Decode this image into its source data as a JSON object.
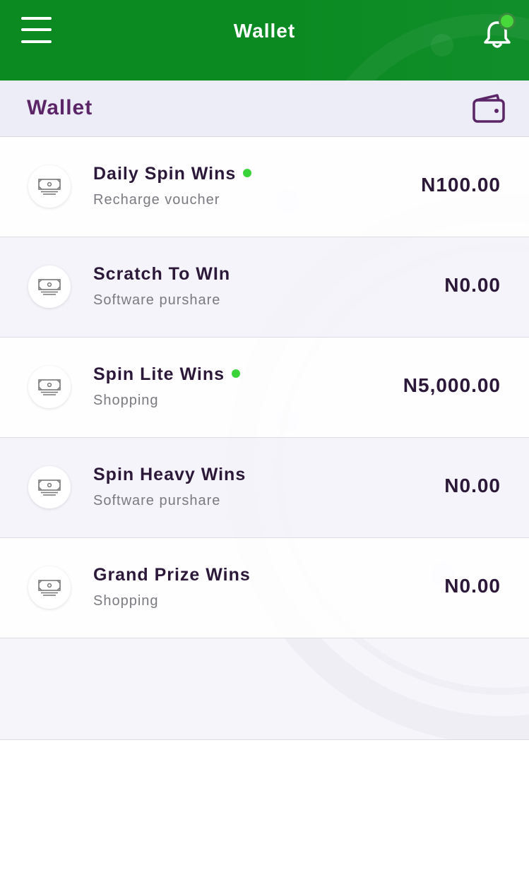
{
  "header": {
    "title": "Wallet",
    "menu_icon": "hamburger-menu-icon",
    "bell_icon": "notification-bell-icon",
    "bell_badge_color": "#47d83a",
    "background_color": "#0b8a22"
  },
  "section": {
    "title": "Wallet",
    "icon": "wallet-icon",
    "title_color": "#5b2567"
  },
  "wallets": [
    {
      "name": "Daily Spin Wins",
      "subtitle": "Recharge voucher",
      "amount": "N100.00",
      "active": true
    },
    {
      "name": "Scratch To WIn",
      "subtitle": "Software purshare",
      "amount": "N0.00",
      "active": false
    },
    {
      "name": "Spin Lite Wins",
      "subtitle": "Shopping",
      "amount": "N5,000.00",
      "active": true
    },
    {
      "name": "Spin Heavy Wins",
      "subtitle": "Software purshare",
      "amount": "N0.00",
      "active": false
    },
    {
      "name": "Grand Prize Wins",
      "subtitle": "Shopping",
      "amount": "N0.00",
      "active": false
    }
  ],
  "row_icon": "money-bill-icon",
  "active_dot_color": "#3ad43a"
}
